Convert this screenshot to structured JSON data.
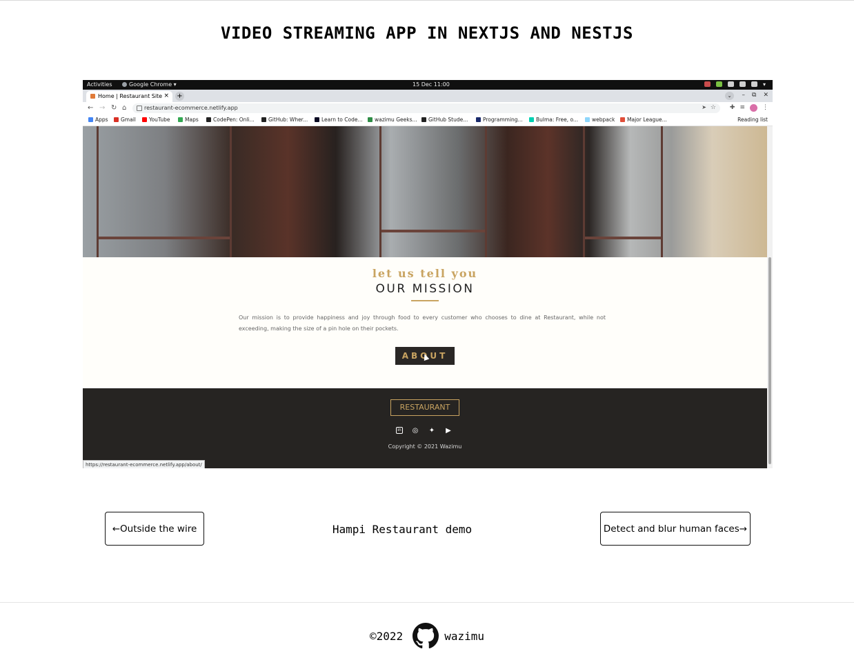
{
  "page": {
    "title": "VIDEO STREAMING APP IN NEXTJS AND NESTJS"
  },
  "screenshot": {
    "gnome": {
      "activities": "Activities",
      "app_menu": "Google Chrome ▾",
      "clock": "15 Dec  11:00"
    },
    "tab": {
      "title": "Home | Restaurant Site",
      "close": "×",
      "new_tab": "+"
    },
    "omnibox": {
      "url": "restaurant-ecommerce.netlify.app"
    },
    "bookmarks": [
      {
        "label": "Apps",
        "color": "#4285f4"
      },
      {
        "label": "Gmail",
        "color": "#d93025"
      },
      {
        "label": "YouTube",
        "color": "#ff0000"
      },
      {
        "label": "Maps",
        "color": "#34a853"
      },
      {
        "label": "CodePen: Onli...",
        "color": "#222222"
      },
      {
        "label": "GitHub: Wher...",
        "color": "#222222"
      },
      {
        "label": "Learn to Code...",
        "color": "#0a0a23"
      },
      {
        "label": "wazimu Geeks...",
        "color": "#2f8d46"
      },
      {
        "label": "GitHub Stude...",
        "color": "#222222"
      },
      {
        "label": "Programming...",
        "color": "#1a2a6c"
      },
      {
        "label": "Bulma: Free, o...",
        "color": "#00d1b2"
      },
      {
        "label": "webpack",
        "color": "#8ed6fb"
      },
      {
        "label": "Major League...",
        "color": "#e04e39"
      }
    ],
    "reading_list": "Reading list",
    "mission": {
      "kicker": "let us tell you",
      "title": "OUR MISSION",
      "text": "Our mission is to provide happiness and joy through food to every customer who chooses to dine at Restaurant, while not exceeding, making the size of a pin hole on their pockets.",
      "button": "ABOUT"
    },
    "footer": {
      "logo": "RESTAURANT",
      "copyright": "Copyright © 2021 Wazimu"
    },
    "status_url": "https://restaurant-ecommerce.netlify.app/about/"
  },
  "pagination": {
    "prev": "←Outside the wire",
    "center": "Hampi Restaurant demo",
    "next": "Detect and blur human faces→"
  },
  "site_footer": {
    "year": "©2022",
    "author": "wazimu"
  },
  "colors": {
    "gold": "#c9a461",
    "dark": "#262422"
  }
}
